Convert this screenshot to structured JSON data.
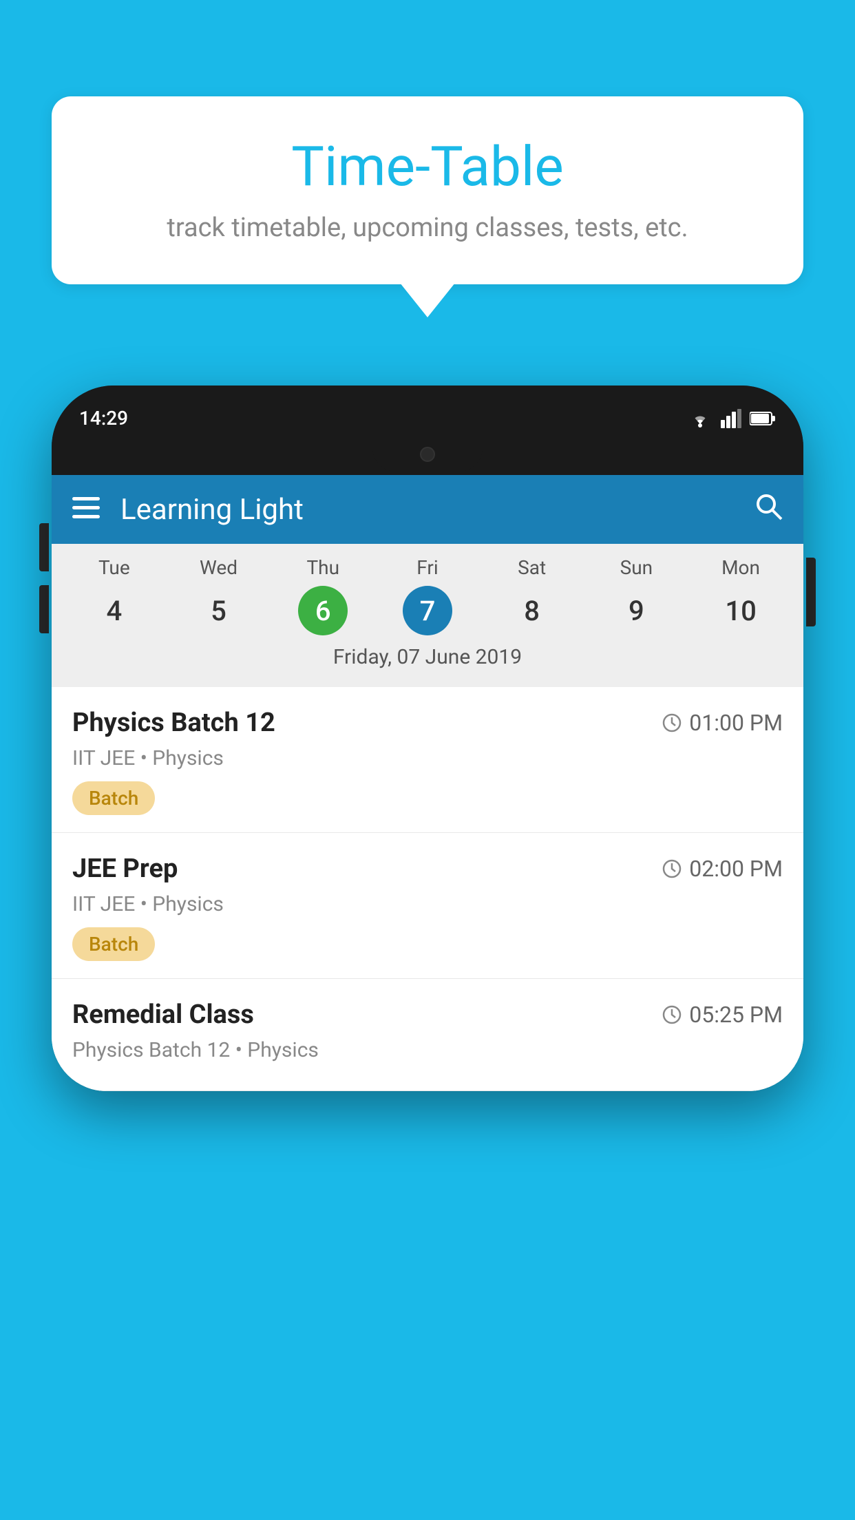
{
  "background_color": "#1ab9e8",
  "speech_bubble": {
    "title": "Time-Table",
    "subtitle": "track timetable, upcoming classes, tests, etc."
  },
  "phone": {
    "status_bar": {
      "time": "14:29"
    },
    "app_bar": {
      "title": "Learning Light"
    },
    "calendar": {
      "days": [
        {
          "name": "Tue",
          "num": "4",
          "state": "normal"
        },
        {
          "name": "Wed",
          "num": "5",
          "state": "normal"
        },
        {
          "name": "Thu",
          "num": "6",
          "state": "today"
        },
        {
          "name": "Fri",
          "num": "7",
          "state": "selected"
        },
        {
          "name": "Sat",
          "num": "8",
          "state": "normal"
        },
        {
          "name": "Sun",
          "num": "9",
          "state": "normal"
        },
        {
          "name": "Mon",
          "num": "10",
          "state": "normal"
        }
      ],
      "selected_date_label": "Friday, 07 June 2019"
    },
    "schedule": [
      {
        "title": "Physics Batch 12",
        "time": "01:00 PM",
        "meta": "IIT JEE • Physics",
        "badge": "Batch"
      },
      {
        "title": "JEE Prep",
        "time": "02:00 PM",
        "meta": "IIT JEE • Physics",
        "badge": "Batch"
      },
      {
        "title": "Remedial Class",
        "time": "05:25 PM",
        "meta": "Physics Batch 12 • Physics",
        "badge": null
      }
    ]
  },
  "icons": {
    "hamburger": "☰",
    "search": "🔍",
    "clock": "🕐"
  }
}
